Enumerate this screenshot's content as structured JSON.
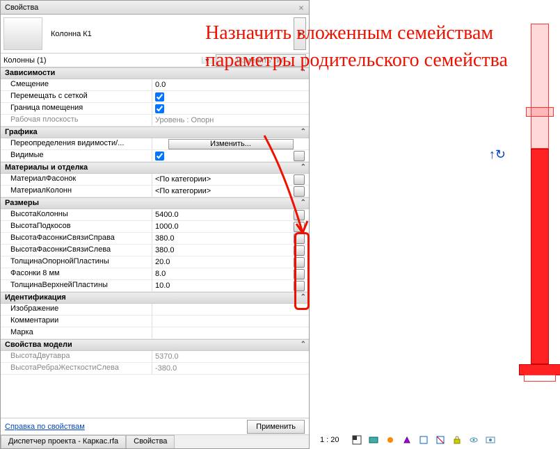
{
  "panel": {
    "title": "Свойства"
  },
  "type": {
    "name": "Колонна К1"
  },
  "instance": {
    "label": "Колонны (1)",
    "edit_type": "Изменить тип"
  },
  "annotation": "Назначить вложенным семействам параметры родительского семейства",
  "groups": [
    {
      "name": "Зависимости",
      "rows": [
        {
          "label": "Смещение",
          "value": "0.0",
          "assoc": false
        },
        {
          "label": "Перемещать с сеткой",
          "value": "",
          "check": true,
          "checked": true
        },
        {
          "label": "Граница помещения",
          "value": "",
          "check": true,
          "checked": true
        },
        {
          "label": "Рабочая плоскость",
          "value": "Уровень : Опорн",
          "gray": true
        }
      ]
    },
    {
      "name": "Графика",
      "rows": [
        {
          "label": "Переопределения видимости/...",
          "value": "",
          "button": "Изменить..."
        },
        {
          "label": "Видимые",
          "value": "",
          "check": true,
          "checked": true,
          "assoc": true
        }
      ]
    },
    {
      "name": "Материалы и отделка",
      "rows": [
        {
          "label": "МатериалФасонок",
          "value": "<По категории>",
          "assoc": true
        },
        {
          "label": "МатериалКолонн",
          "value": "<По категории>",
          "assoc": true
        }
      ]
    },
    {
      "name": "Размеры",
      "rows": [
        {
          "label": "ВысотаКолонны",
          "value": "5400.0",
          "assoc": true
        },
        {
          "label": "ВысотаПодкосов",
          "value": "1000.0",
          "assoc": true
        },
        {
          "label": "ВысотаФасонкиСвязиСправа",
          "value": "380.0",
          "assoc": true
        },
        {
          "label": "ВысотаФасонкиСвязиСлева",
          "value": "380.0",
          "assoc": true
        },
        {
          "label": "ТолщинаОпорнойПластины",
          "value": "20.0",
          "assoc": true
        },
        {
          "label": "Фасонки 8 мм",
          "value": "8.0",
          "assoc": true
        },
        {
          "label": "ТолщинаВерхнейПластины",
          "value": "10.0",
          "assoc": true
        }
      ]
    },
    {
      "name": "Идентификация",
      "rows": [
        {
          "label": "Изображение",
          "value": ""
        },
        {
          "label": "Комментарии",
          "value": ""
        },
        {
          "label": "Марка",
          "value": ""
        }
      ]
    },
    {
      "name": "Свойства модели",
      "rows": [
        {
          "label": "ВысотаДвутавра",
          "value": "5370.0",
          "gray": true
        },
        {
          "label": "ВысотаРебраЖесткостиСлева",
          "value": "-380.0",
          "gray": true
        }
      ]
    }
  ],
  "footer": {
    "help": "Справка по свойствам",
    "apply": "Применить"
  },
  "tabs": {
    "project_browser": "Диспетчер проекта - Каркас.rfa",
    "properties": "Свойства"
  },
  "status": {
    "scale": "1 : 20"
  }
}
